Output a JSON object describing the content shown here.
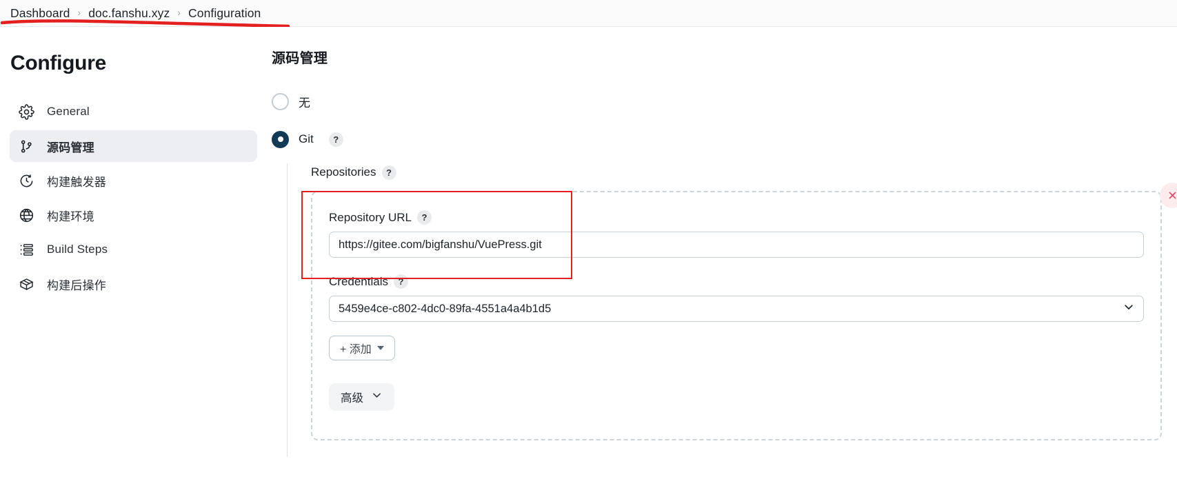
{
  "breadcrumb": {
    "items": [
      {
        "label": "Dashboard"
      },
      {
        "label": "doc.fanshu.xyz"
      },
      {
        "label": "Configuration"
      }
    ],
    "separator": "›"
  },
  "sidebar": {
    "heading": "Configure",
    "items": [
      {
        "label": "General",
        "icon": "gear-icon",
        "active": false
      },
      {
        "label": "源码管理",
        "icon": "git-branch-icon",
        "active": true
      },
      {
        "label": "构建触发器",
        "icon": "clock-icon",
        "active": false
      },
      {
        "label": "构建环境",
        "icon": "globe-icon",
        "active": false
      },
      {
        "label": "Build Steps",
        "icon": "list-steps-icon",
        "active": false
      },
      {
        "label": "构建后操作",
        "icon": "package-icon",
        "active": false
      }
    ]
  },
  "main": {
    "section_title": "源码管理",
    "scm_options": [
      {
        "label": "无",
        "checked": false,
        "has_help": false
      },
      {
        "label": "Git",
        "checked": true,
        "has_help": true
      }
    ],
    "help_glyph": "?",
    "git": {
      "repositories_label": "Repositories",
      "repository_url_label": "Repository URL",
      "repository_url_value": "https://gitee.com/bigfanshu/VuePress.git",
      "credentials_label": "Credentials",
      "credentials_value": "5459e4ce-c802-4dc0-89fa-4551a4a4b1d5",
      "add_button_label": "+ 添加",
      "advanced_button_label": "高级",
      "delete_button_label": "×"
    }
  },
  "colors": {
    "accent_selected": "#123a55",
    "annotation_red": "#e41f1f",
    "delete_red": "#e5415a",
    "sidebar_active_bg": "#eceef1"
  }
}
